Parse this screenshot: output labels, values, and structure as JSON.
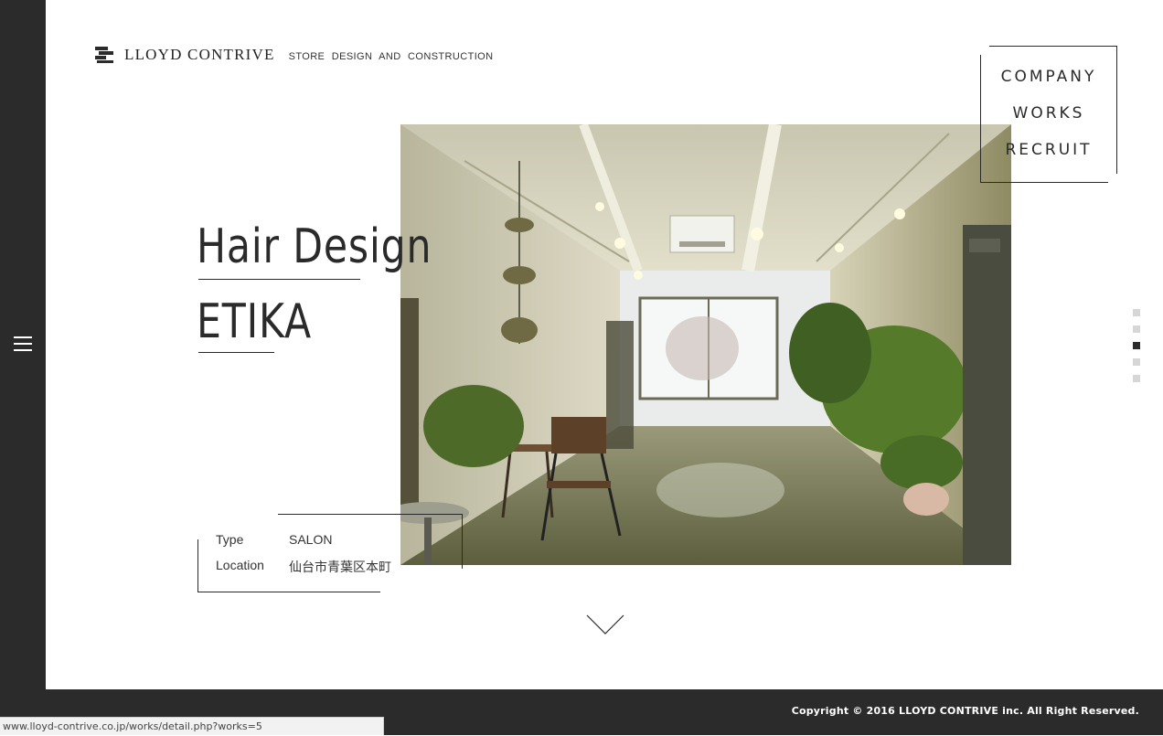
{
  "header": {
    "logo_name": "LLOYD CONTRIVE",
    "logo_tagline": "STORE DESIGN AND CONSTRUCTION"
  },
  "nav": {
    "items": [
      {
        "label": "COMPANY"
      },
      {
        "label": "WORKS"
      },
      {
        "label": "RECRUIT"
      }
    ]
  },
  "work": {
    "title_line1": "Hair Design",
    "title_line2": "ETIKA",
    "details": [
      {
        "key": "Type",
        "value": "SALON"
      },
      {
        "key": "Location",
        "value": "仙台市青葉区本町"
      }
    ]
  },
  "pager": {
    "count": 5,
    "active_index": 2
  },
  "footer": {
    "copyright": "Copyright © 2016 LLOYD CONTRIVE inc. All Right Reserved."
  },
  "statusbar": {
    "url": "www.lloyd-contrive.co.jp/works/detail.php?works=5"
  },
  "colors": {
    "dark": "#2b2b2b",
    "pager_inactive": "#d6d6d6",
    "background": "#ffffff"
  },
  "icons": {
    "menu": "hamburger-icon",
    "scroll": "chevron-down-icon",
    "logo": "logo-mark-icon"
  }
}
